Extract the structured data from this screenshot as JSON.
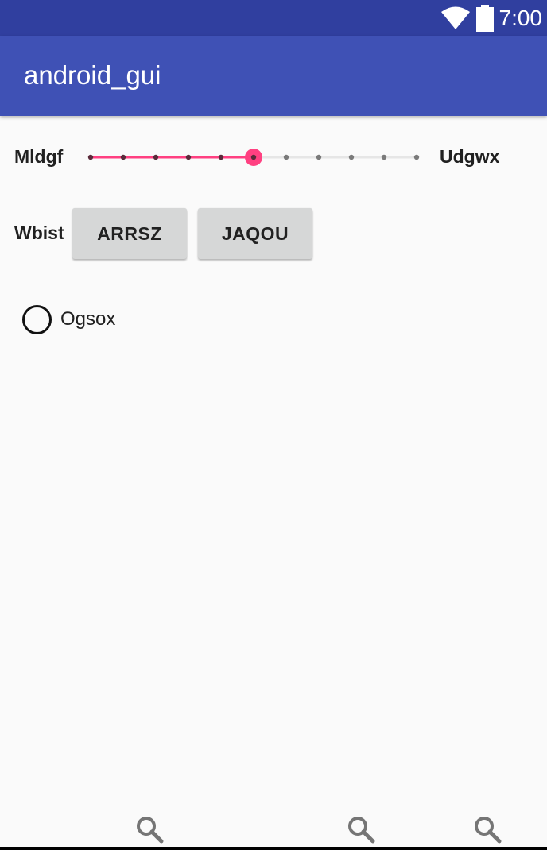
{
  "status_bar": {
    "time": "7:00",
    "icons": [
      "wifi-icon",
      "battery-icon"
    ],
    "color": "#303f9f"
  },
  "app_bar": {
    "title": "android_gui",
    "color": "#3f51b5"
  },
  "slider_row": {
    "left_label": "Mldgf",
    "right_label": "Udgwx",
    "steps": 10,
    "value_fraction": 0.5,
    "accent": "#ff4081"
  },
  "button_row": {
    "label": "Wbist",
    "buttons": [
      "ARRSZ",
      "JAQOU"
    ]
  },
  "radio": {
    "label": "Ogsox",
    "checked": false
  },
  "bottom_icons": [
    "search-icon",
    "search-icon",
    "search-icon"
  ]
}
